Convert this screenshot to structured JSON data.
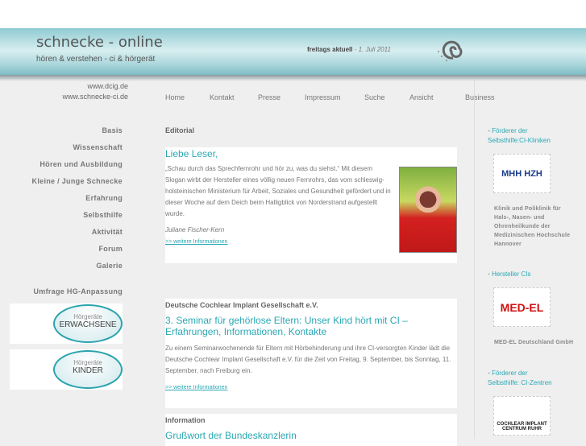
{
  "header": {
    "title": "schnecke - online",
    "tagline": "hören & verstehen  - ci & hörgerät",
    "news_label": "freitags aktuell",
    "news_date": " - 1. Juli 2011"
  },
  "urls": [
    "www.dcig.de",
    "www.schnecke-ci.de"
  ],
  "topnav": [
    "Home",
    "Kontakt",
    "Presse",
    "Impressum",
    "Suche",
    "Ansicht",
    "Business"
  ],
  "leftmenu": [
    "Basis",
    "Wissenschaft",
    "Hören und Ausbildung",
    "Kleine / Junge Schnecke",
    "Erfahrung",
    "Selbsthilfe",
    "Aktivität",
    "Forum",
    "Galerie"
  ],
  "survey": {
    "label": "Umfrage HG-Anpassung",
    "buttons": [
      {
        "small": "Hörgeräte",
        "big": "ERWACHSENE"
      },
      {
        "small": "Hörgeräte",
        "big": "KINDER"
      }
    ]
  },
  "articles": [
    {
      "section": "Editorial",
      "title": "Liebe Leser,",
      "text": "„Schau durch das Sprechfernrohr und hör zu, was du siehst.“ Mit diesem Slogan wirbt der Hersteller eines völlig neuen Fernrohrs, das vom schleswig-holsteinischen Ministerium für Arbeit, Soziales und Gesundheit gefördert und in dieser Woche auf dem Deich beim Halligblick von Norderstrand aufgestellt wurde.",
      "author": "Juliane Fischer-Kern",
      "more": ">> weitere Informationen"
    },
    {
      "section": "Deutsche Cochlear Implant Gesellschaft e.V.",
      "title": "3. Seminar für gehörlose Eltern: Unser Kind hört mit CI – Erfahrungen, Informationen, Kontakte",
      "text": "Zu einem Seminarwochenende für Eltern mit Hörbehinderung und ihre CI-versorgten Kinder lädt die Deutsche Cochlear Implant Gesellschaft e.V. für die Zeit von Freitag, 9. September, bis Sonntag, 11. September, nach Freiburg ein.",
      "more": ">> weitere Informationen"
    },
    {
      "section": "Information",
      "title": "Grußwort der Bundeskanzlerin"
    }
  ],
  "sidebar": [
    {
      "link": "Förderer der Selbsthilfe:CI-Kliniken",
      "logo": "MHH HZH",
      "caption": "Klinik und Poliklinik für Hals-, Nasen- und Ohrenheilkunde der Medizinischen Hochschule Hannover"
    },
    {
      "link": "Hersteller CIs",
      "logo": "MED-EL",
      "caption": "MED-EL Deutschland GmbH"
    },
    {
      "link": "Förderer der Selbsthilfe: CI-Zentren",
      "logo": "COCHLEAR IMPLANT CENTRUM RUHR"
    }
  ]
}
